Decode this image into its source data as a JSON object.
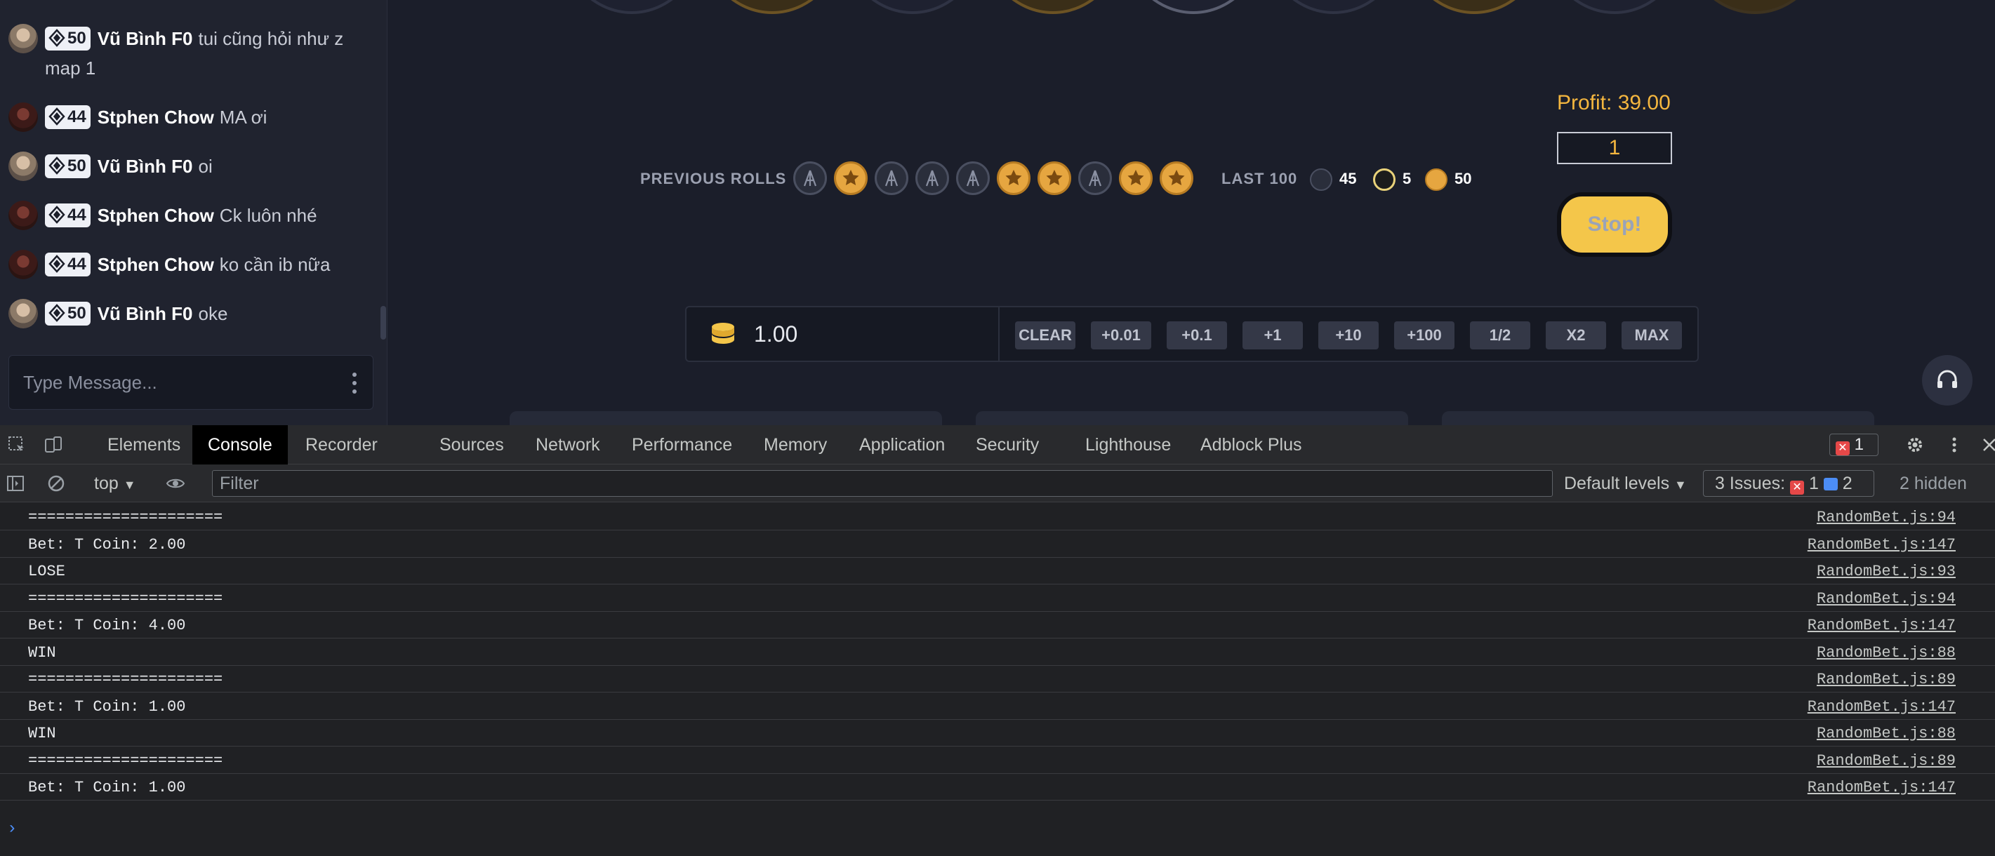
{
  "chat": {
    "messages": [
      {
        "level": "50",
        "user": "Vũ Bình F0",
        "text": "tui cũng hỏi như z map 1",
        "avatar": "vu"
      },
      {
        "level": "44",
        "user": "Stphen Chow",
        "text": "MA ơi",
        "avatar": "st"
      },
      {
        "level": "50",
        "user": "Vũ Bình F0",
        "text": "oi",
        "avatar": "vu"
      },
      {
        "level": "44",
        "user": "Stphen Chow",
        "text": "Ck luôn nhé",
        "avatar": "st"
      },
      {
        "level": "44",
        "user": "Stphen Chow",
        "text": "ko cần ib nữa",
        "avatar": "st"
      },
      {
        "level": "50",
        "user": "Vũ Bình F0",
        "text": "oke",
        "avatar": "vu"
      }
    ],
    "input_placeholder": "Type Message..."
  },
  "game": {
    "previous_rolls_label": "PREVIOUS ROLLS",
    "previous_rolls": [
      "ct",
      "t",
      "ct",
      "ct",
      "ct",
      "t",
      "t",
      "ct",
      "t",
      "t"
    ],
    "last100_label": "LAST 100",
    "last100": {
      "ct": "45",
      "bonus": "5",
      "t": "50"
    },
    "profit_label": "Profit: 39.00",
    "profit_input_value": "1",
    "stop_label": "Stop!",
    "bet_amount": "1.00",
    "bet_buttons": [
      "CLEAR",
      "+0.01",
      "+0.1",
      "+1",
      "+10",
      "+100",
      "1/2",
      "X2",
      "MAX"
    ],
    "colors": {
      "gold": "#f4b63f",
      "ct": "#2a2e3b",
      "t": "#e6a640"
    }
  },
  "devtools": {
    "tabs": [
      "Elements",
      "Console",
      "Recorder",
      "Sources",
      "Network",
      "Performance",
      "Memory",
      "Application",
      "Security",
      "Lighthouse",
      "Adblock Plus"
    ],
    "active_tab": "Console",
    "error_count": "1",
    "context": "top",
    "filter_placeholder": "Filter",
    "levels": "Default levels",
    "issues_label": "3 Issues:",
    "issues_errors": "1",
    "issues_messages": "2",
    "hidden": "2 hidden",
    "logs": [
      {
        "msg": "=====================",
        "src": "RandomBet.js:94"
      },
      {
        "msg": "Bet: T Coin: 2.00",
        "src": "RandomBet.js:147"
      },
      {
        "msg": "LOSE",
        "src": "RandomBet.js:93"
      },
      {
        "msg": "=====================",
        "src": "RandomBet.js:94"
      },
      {
        "msg": "Bet: T Coin: 4.00",
        "src": "RandomBet.js:147"
      },
      {
        "msg": "WIN",
        "src": "RandomBet.js:88"
      },
      {
        "msg": "=====================",
        "src": "RandomBet.js:89"
      },
      {
        "msg": "Bet: T Coin: 1.00",
        "src": "RandomBet.js:147"
      },
      {
        "msg": "WIN",
        "src": "RandomBet.js:88"
      },
      {
        "msg": "=====================",
        "src": "RandomBet.js:89"
      },
      {
        "msg": "Bet: T Coin: 1.00",
        "src": "RandomBet.js:147"
      }
    ],
    "prompt": "›"
  }
}
